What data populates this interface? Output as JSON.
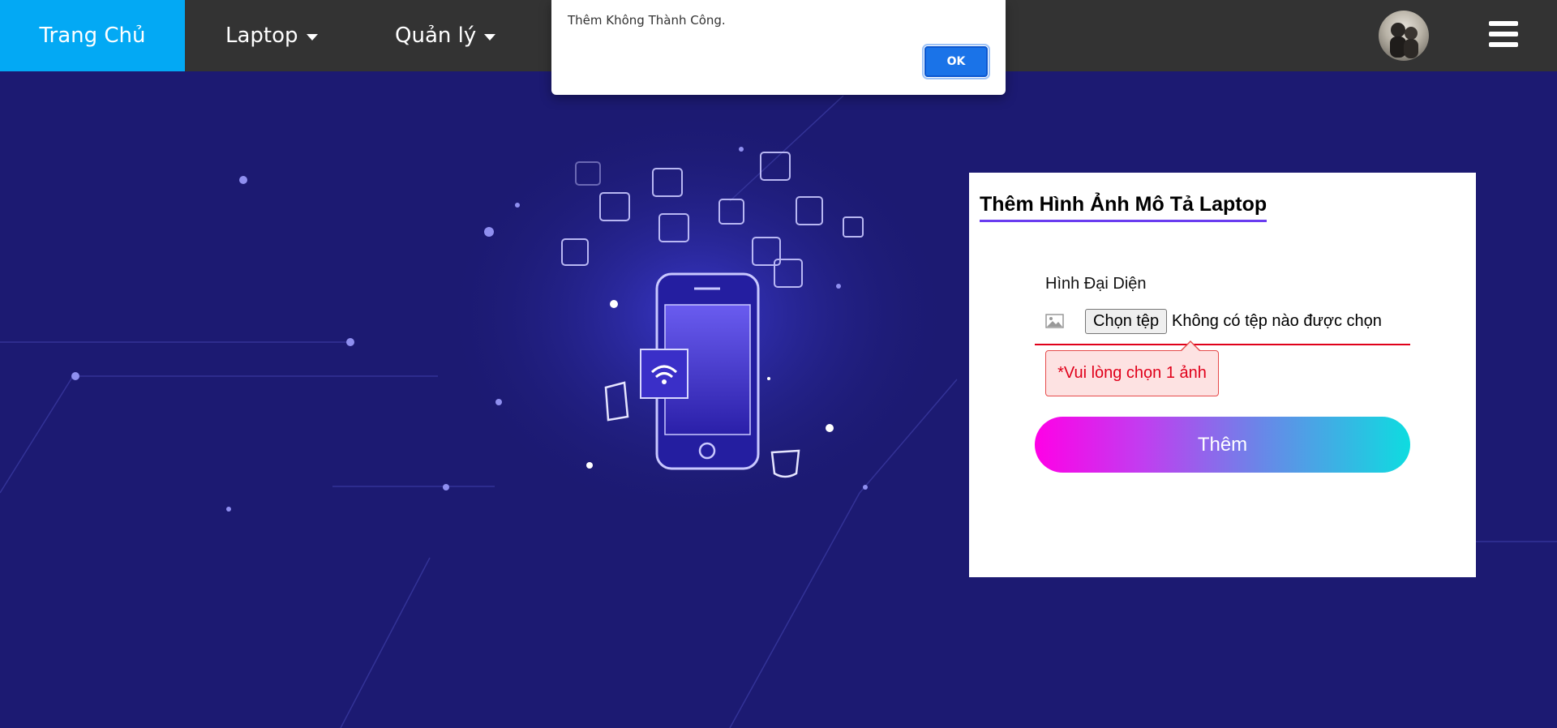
{
  "navbar": {
    "home_label": "Trang Chủ",
    "laptop_label": "Laptop",
    "manage_label": "Quản lý",
    "home_color": "#03a9f4",
    "background": "#333333"
  },
  "dialog": {
    "message": "Thêm Không Thành Công.",
    "ok_label": "OK"
  },
  "form": {
    "title": "Thêm Hình Ảnh Mô Tả Laptop",
    "field_label": "Hình Đại Diện",
    "file_button_label": "Chọn tệp",
    "file_status": "Không có tệp nào được chọn",
    "error_message": "*Vui lòng chọn 1 ảnh",
    "submit_label": "Thêm"
  },
  "icons": {
    "menu": "hamburger-icon",
    "avatar": "user-avatar",
    "field": "image-icon",
    "dropdown": "caret-down-icon"
  },
  "colors": {
    "page_background": "#1c1a72",
    "title_underline": "#6a3cf0",
    "error": "#e0001a",
    "ok_button": "#1a73e8"
  }
}
